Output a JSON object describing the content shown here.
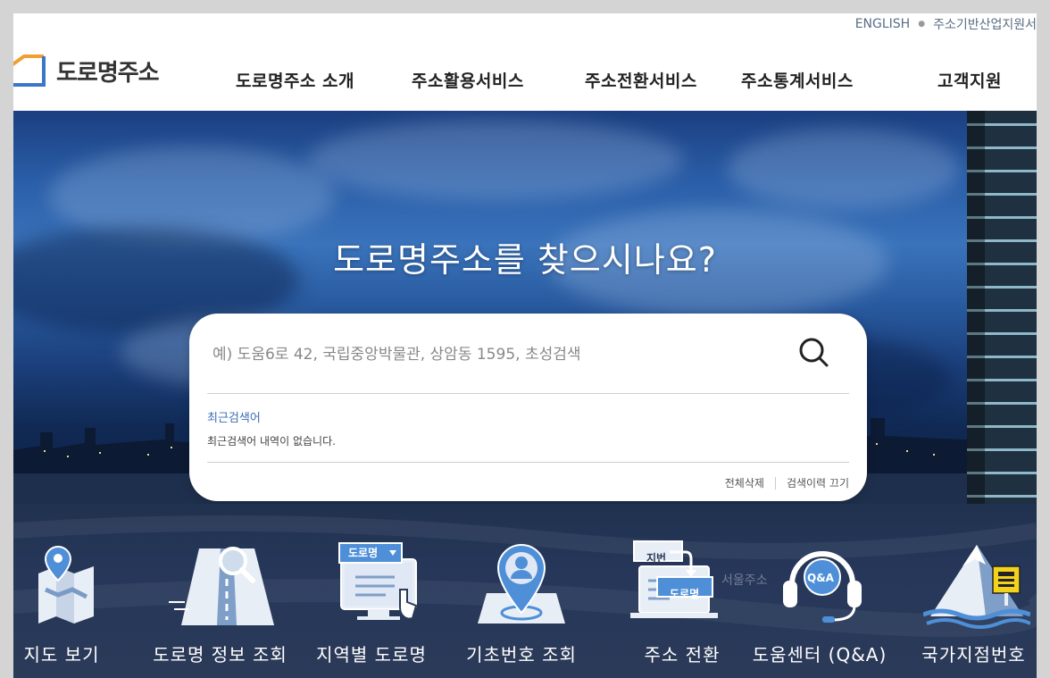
{
  "util_links": [
    "ENGLISH",
    "주소기반산업지원서"
  ],
  "logo": {
    "text": "도로명주소"
  },
  "nav": [
    "도로명주소 소개",
    "주소활용서비스",
    "주소전환서비스",
    "주소통계서비스",
    "고객지원"
  ],
  "hero": {
    "title": "도로명주소를 찾으시나요?"
  },
  "search": {
    "placeholder": "예) 도움6로 42, 국립중앙박물관, 상암동 1595, 초성검색",
    "recent_title": "최근검색어",
    "recent_empty": "최근검색어 내역이 없습니다.",
    "delete_all": "전체삭제",
    "history_off": "검색이력 끄기"
  },
  "quick_menu": [
    {
      "label": "지도 보기",
      "icon": "map-pin-icon"
    },
    {
      "label": "도로명 정보 조회",
      "icon": "road-magnifier-icon"
    },
    {
      "label": "지역별 도로명",
      "icon": "computer-select-icon",
      "badge": "도로명"
    },
    {
      "label": "기초번호 조회",
      "icon": "location-person-icon"
    },
    {
      "label": "주소 전환",
      "icon": "address-convert-icon",
      "badge_top": "지번",
      "badge_bottom": "도로명"
    },
    {
      "label": "도움센터 (Q&A)",
      "icon": "headset-qa-icon",
      "badge": "Q&A"
    },
    {
      "label": "국가지점번호",
      "icon": "mountain-marker-icon"
    }
  ],
  "watermark": "서울주소",
  "colors": {
    "accent": "#3d6db5",
    "logo_orange": "#f0a030",
    "logo_blue": "#3b76c8"
  }
}
